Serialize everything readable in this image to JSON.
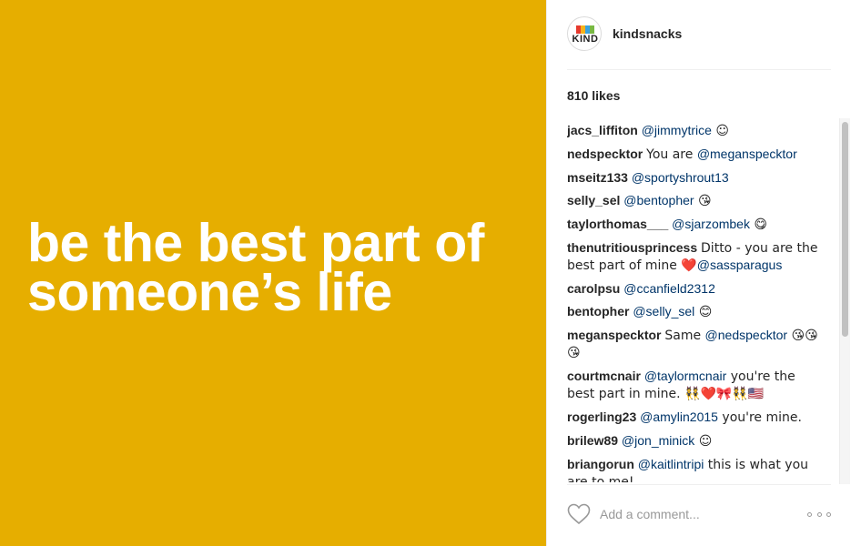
{
  "photo": {
    "background_color": "#e6ae00",
    "lines": [
      "be the best part of",
      "someone’s life"
    ]
  },
  "post": {
    "username": "kindsnacks",
    "avatar_logo_text": "KIND",
    "likes": "810 likes"
  },
  "colors": {
    "mention": "#003569",
    "text": "#262626",
    "placeholder": "#999999"
  },
  "comments": [
    {
      "user": "jacs_liffiton",
      "parts": [
        {
          "t": "mention",
          "v": "@jimmytrice"
        },
        {
          "t": "text",
          "v": " ☺"
        }
      ]
    },
    {
      "user": "nedspecktor",
      "parts": [
        {
          "t": "text",
          "v": "You are "
        },
        {
          "t": "mention",
          "v": "@meganspecktor"
        }
      ]
    },
    {
      "user": "mseitz133",
      "parts": [
        {
          "t": "mention",
          "v": "@sportyshrout13"
        }
      ]
    },
    {
      "user": "selly_sel",
      "parts": [
        {
          "t": "mention",
          "v": "@bentopher"
        },
        {
          "t": "text",
          "v": " 😘"
        }
      ]
    },
    {
      "user": "taylorthomas___",
      "parts": [
        {
          "t": "mention",
          "v": "@sjarzombek"
        },
        {
          "t": "text",
          "v": " 😋"
        }
      ]
    },
    {
      "user": "thenutritiousprincess",
      "parts": [
        {
          "t": "text",
          "v": "Ditto - you are the best part of mine ❤️"
        },
        {
          "t": "mention",
          "v": "@sassparagus"
        }
      ]
    },
    {
      "user": "carolpsu",
      "parts": [
        {
          "t": "mention",
          "v": "@ccanfield2312"
        }
      ]
    },
    {
      "user": "bentopher",
      "parts": [
        {
          "t": "mention",
          "v": "@selly_sel"
        },
        {
          "t": "text",
          "v": " 😊"
        }
      ]
    },
    {
      "user": "meganspecktor",
      "parts": [
        {
          "t": "text",
          "v": "Same "
        },
        {
          "t": "mention",
          "v": "@nedspecktor"
        },
        {
          "t": "text",
          "v": " 😘😘😘"
        }
      ]
    },
    {
      "user": "courtmcnair",
      "parts": [
        {
          "t": "mention",
          "v": "@taylormcnair"
        },
        {
          "t": "text",
          "v": " you're the best part in mine. 👯❤️🎀👯🇺🇸"
        }
      ]
    },
    {
      "user": "rogerling23",
      "parts": [
        {
          "t": "mention",
          "v": "@amylin2015"
        },
        {
          "t": "text",
          "v": " you're mine."
        }
      ]
    },
    {
      "user": "brilew89",
      "parts": [
        {
          "t": "mention",
          "v": "@jon_minick"
        },
        {
          "t": "text",
          "v": " ☺"
        }
      ]
    },
    {
      "user": "briangorun",
      "parts": [
        {
          "t": "mention",
          "v": "@kaitlintripi"
        },
        {
          "t": "text",
          "v": " this is what you are to me!"
        }
      ]
    }
  ],
  "add_comment": {
    "placeholder": "Add a comment...",
    "like_icon": "heart-outline-icon",
    "more_icon": "more-options-icon"
  }
}
